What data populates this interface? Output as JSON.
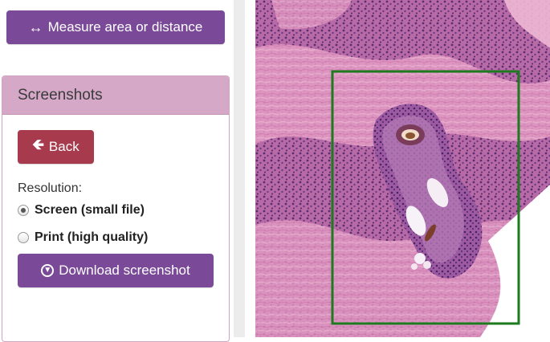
{
  "toolbar": {
    "measure_label": "Measure area or distance",
    "measure_icon": "left-right-arrow-icon"
  },
  "screenshots_panel": {
    "title": "Screenshots",
    "back_label": "Back",
    "back_icon": "arrow-left-icon",
    "resolution_label": "Resolution:",
    "options": [
      {
        "label": "Screen (small file)",
        "selected": true
      },
      {
        "label": "Print (high quality)",
        "selected": false
      }
    ],
    "download_label": "Download screenshot",
    "download_icon": "circle-arrow-down-icon"
  },
  "colors": {
    "primary_button": "#7a4a98",
    "back_button": "#a83a4e",
    "panel_header": "#d5a8c7",
    "selection_box": "#1e7a1e",
    "tissue_pink": "#dd8db8",
    "tissue_purple": "#8a4f9a"
  }
}
